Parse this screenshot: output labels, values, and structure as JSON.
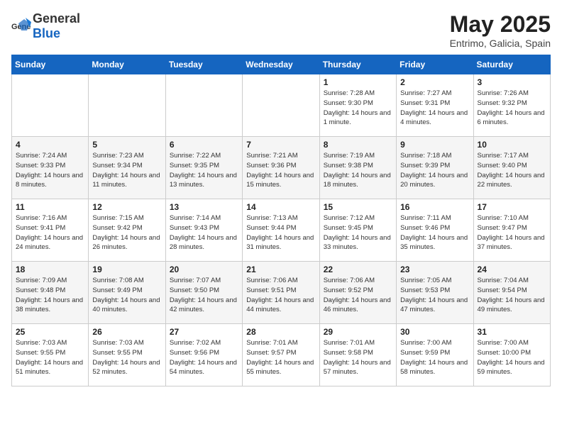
{
  "header": {
    "logo_general": "General",
    "logo_blue": "Blue",
    "month_title": "May 2025",
    "subtitle": "Entrimo, Galicia, Spain"
  },
  "weekdays": [
    "Sunday",
    "Monday",
    "Tuesday",
    "Wednesday",
    "Thursday",
    "Friday",
    "Saturday"
  ],
  "weeks": [
    [
      {
        "day": "",
        "info": ""
      },
      {
        "day": "",
        "info": ""
      },
      {
        "day": "",
        "info": ""
      },
      {
        "day": "",
        "info": ""
      },
      {
        "day": "1",
        "info": "Sunrise: 7:28 AM\nSunset: 9:30 PM\nDaylight: 14 hours and 1 minute."
      },
      {
        "day": "2",
        "info": "Sunrise: 7:27 AM\nSunset: 9:31 PM\nDaylight: 14 hours and 4 minutes."
      },
      {
        "day": "3",
        "info": "Sunrise: 7:26 AM\nSunset: 9:32 PM\nDaylight: 14 hours and 6 minutes."
      }
    ],
    [
      {
        "day": "4",
        "info": "Sunrise: 7:24 AM\nSunset: 9:33 PM\nDaylight: 14 hours and 8 minutes."
      },
      {
        "day": "5",
        "info": "Sunrise: 7:23 AM\nSunset: 9:34 PM\nDaylight: 14 hours and 11 minutes."
      },
      {
        "day": "6",
        "info": "Sunrise: 7:22 AM\nSunset: 9:35 PM\nDaylight: 14 hours and 13 minutes."
      },
      {
        "day": "7",
        "info": "Sunrise: 7:21 AM\nSunset: 9:36 PM\nDaylight: 14 hours and 15 minutes."
      },
      {
        "day": "8",
        "info": "Sunrise: 7:19 AM\nSunset: 9:38 PM\nDaylight: 14 hours and 18 minutes."
      },
      {
        "day": "9",
        "info": "Sunrise: 7:18 AM\nSunset: 9:39 PM\nDaylight: 14 hours and 20 minutes."
      },
      {
        "day": "10",
        "info": "Sunrise: 7:17 AM\nSunset: 9:40 PM\nDaylight: 14 hours and 22 minutes."
      }
    ],
    [
      {
        "day": "11",
        "info": "Sunrise: 7:16 AM\nSunset: 9:41 PM\nDaylight: 14 hours and 24 minutes."
      },
      {
        "day": "12",
        "info": "Sunrise: 7:15 AM\nSunset: 9:42 PM\nDaylight: 14 hours and 26 minutes."
      },
      {
        "day": "13",
        "info": "Sunrise: 7:14 AM\nSunset: 9:43 PM\nDaylight: 14 hours and 28 minutes."
      },
      {
        "day": "14",
        "info": "Sunrise: 7:13 AM\nSunset: 9:44 PM\nDaylight: 14 hours and 31 minutes."
      },
      {
        "day": "15",
        "info": "Sunrise: 7:12 AM\nSunset: 9:45 PM\nDaylight: 14 hours and 33 minutes."
      },
      {
        "day": "16",
        "info": "Sunrise: 7:11 AM\nSunset: 9:46 PM\nDaylight: 14 hours and 35 minutes."
      },
      {
        "day": "17",
        "info": "Sunrise: 7:10 AM\nSunset: 9:47 PM\nDaylight: 14 hours and 37 minutes."
      }
    ],
    [
      {
        "day": "18",
        "info": "Sunrise: 7:09 AM\nSunset: 9:48 PM\nDaylight: 14 hours and 38 minutes."
      },
      {
        "day": "19",
        "info": "Sunrise: 7:08 AM\nSunset: 9:49 PM\nDaylight: 14 hours and 40 minutes."
      },
      {
        "day": "20",
        "info": "Sunrise: 7:07 AM\nSunset: 9:50 PM\nDaylight: 14 hours and 42 minutes."
      },
      {
        "day": "21",
        "info": "Sunrise: 7:06 AM\nSunset: 9:51 PM\nDaylight: 14 hours and 44 minutes."
      },
      {
        "day": "22",
        "info": "Sunrise: 7:06 AM\nSunset: 9:52 PM\nDaylight: 14 hours and 46 minutes."
      },
      {
        "day": "23",
        "info": "Sunrise: 7:05 AM\nSunset: 9:53 PM\nDaylight: 14 hours and 47 minutes."
      },
      {
        "day": "24",
        "info": "Sunrise: 7:04 AM\nSunset: 9:54 PM\nDaylight: 14 hours and 49 minutes."
      }
    ],
    [
      {
        "day": "25",
        "info": "Sunrise: 7:03 AM\nSunset: 9:55 PM\nDaylight: 14 hours and 51 minutes."
      },
      {
        "day": "26",
        "info": "Sunrise: 7:03 AM\nSunset: 9:55 PM\nDaylight: 14 hours and 52 minutes."
      },
      {
        "day": "27",
        "info": "Sunrise: 7:02 AM\nSunset: 9:56 PM\nDaylight: 14 hours and 54 minutes."
      },
      {
        "day": "28",
        "info": "Sunrise: 7:01 AM\nSunset: 9:57 PM\nDaylight: 14 hours and 55 minutes."
      },
      {
        "day": "29",
        "info": "Sunrise: 7:01 AM\nSunset: 9:58 PM\nDaylight: 14 hours and 57 minutes."
      },
      {
        "day": "30",
        "info": "Sunrise: 7:00 AM\nSunset: 9:59 PM\nDaylight: 14 hours and 58 minutes."
      },
      {
        "day": "31",
        "info": "Sunrise: 7:00 AM\nSunset: 10:00 PM\nDaylight: 14 hours and 59 minutes."
      }
    ]
  ]
}
